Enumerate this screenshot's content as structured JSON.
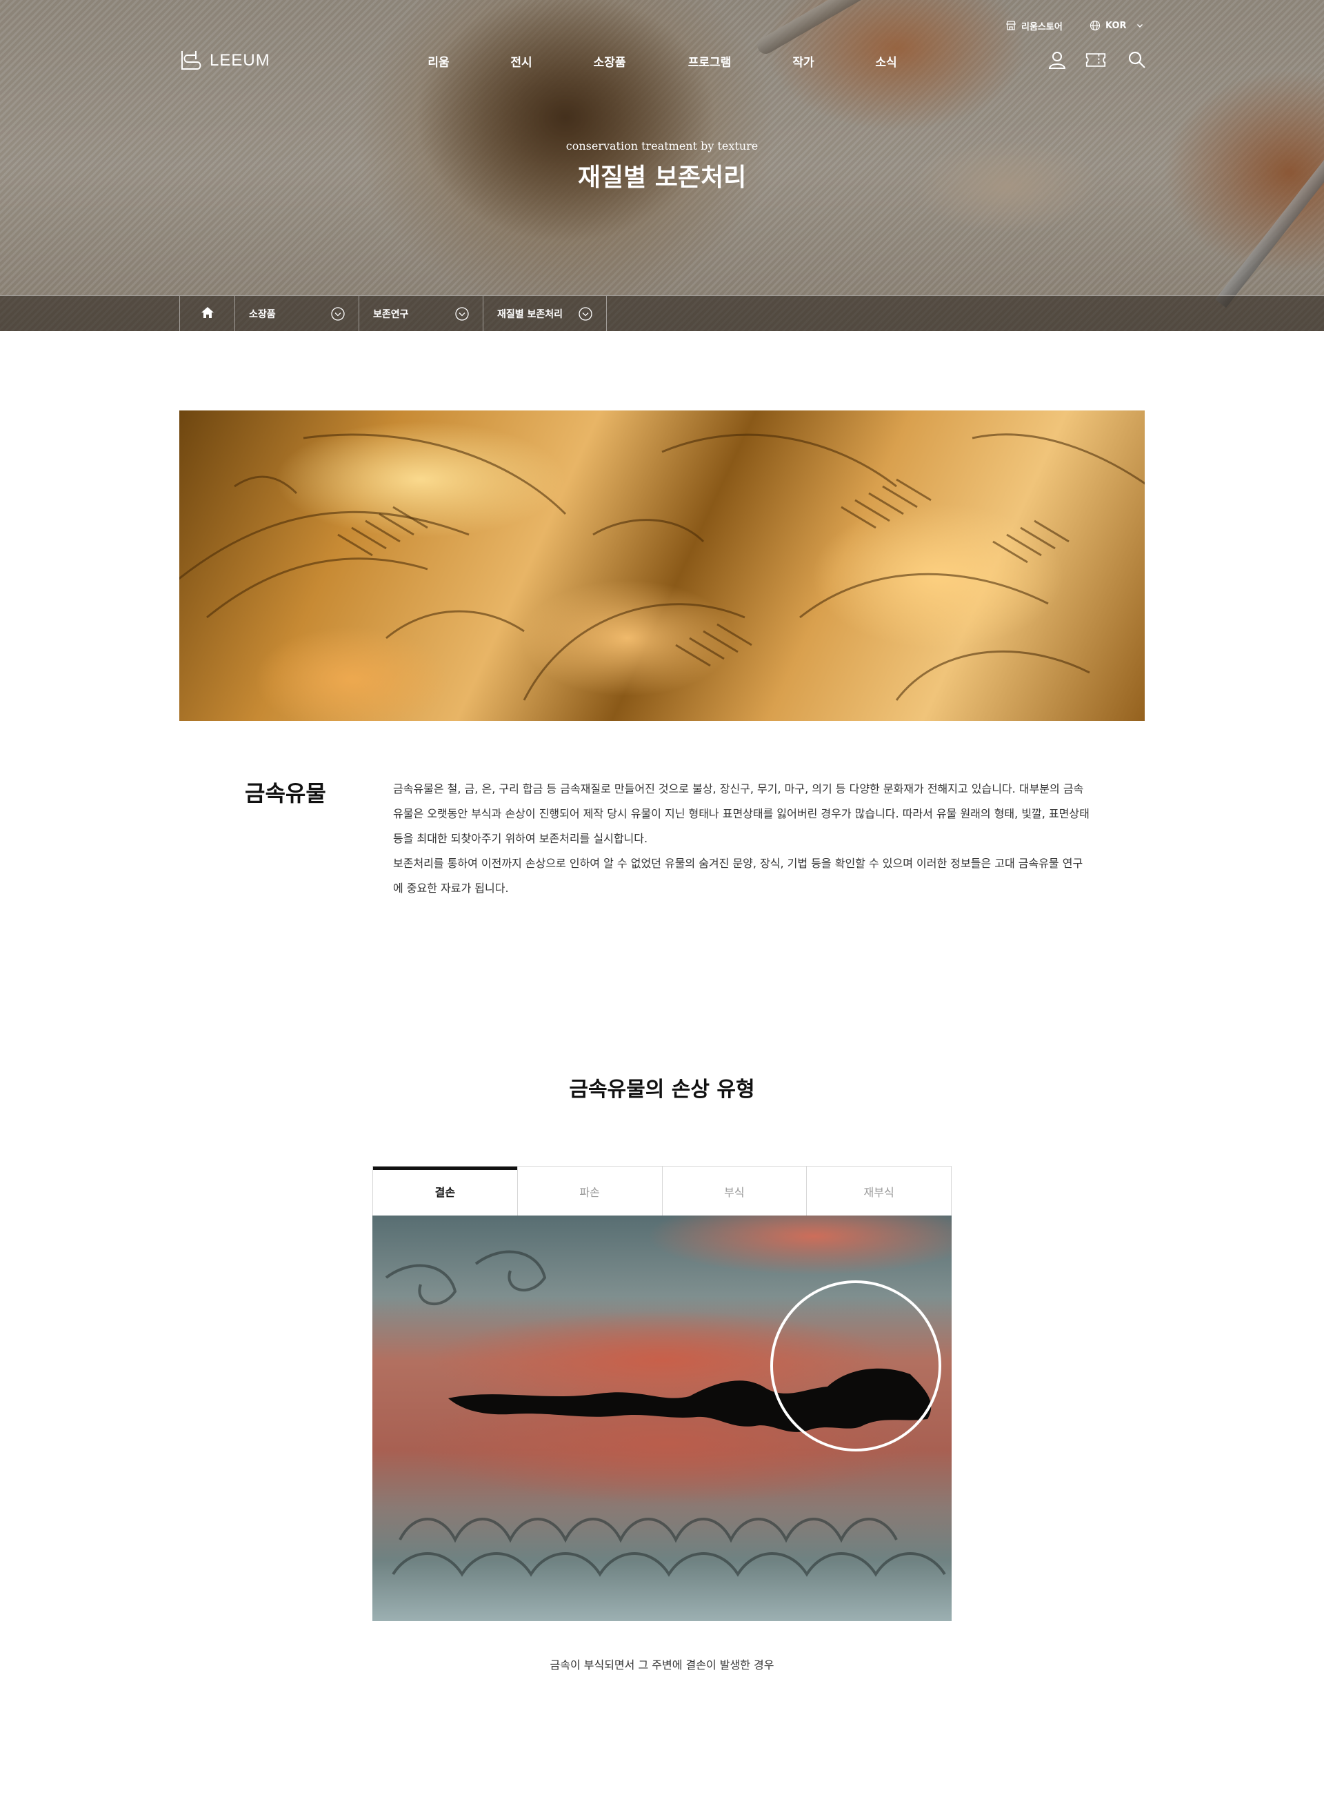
{
  "header": {
    "utility": {
      "store_label": "리움스토어",
      "lang_label": "KOR"
    },
    "logo_text": "LEEUM",
    "nav": [
      {
        "label": "리움"
      },
      {
        "label": "전시"
      },
      {
        "label": "소장품"
      },
      {
        "label": "프로그램"
      },
      {
        "label": "작가"
      },
      {
        "label": "소식"
      }
    ],
    "icons": [
      "user-icon",
      "ticket-icon",
      "search-icon"
    ]
  },
  "hero": {
    "subtitle": "conservation treatment by texture",
    "title": "재질별 보존처리"
  },
  "breadcrumb": {
    "home_icon": "home-icon",
    "items": [
      {
        "label": "소장품"
      },
      {
        "label": "보존연구"
      },
      {
        "label": "재질별 보존처리"
      }
    ]
  },
  "intro": {
    "title": "금속유물",
    "paragraphs": [
      "금속유물은 철, 금, 은, 구리 합금 등 금속재질로 만들어진 것으로 불상, 장신구, 무기, 마구, 의기 등 다양한 문화재가 전해지고 있습니다. 대부분의 금속유물은 오랫동안 부식과 손상이 진행되어 제작 당시 유물이 지닌 형태나 표면상태를 잃어버린 경우가 많습니다. 따라서 유물 원래의 형태, 빛깔, 표면상태 등을 최대한 되찾아주기 위하여 보존처리를 실시합니다.",
      "보존처리를 통하여 이전까지 손상으로 인하여 알 수 없었던 유물의 숨겨진 문양, 장식, 기법 등을 확인할 수 있으며 이러한 정보들은 고대 금속유물 연구에 중요한 자료가 됩니다."
    ]
  },
  "damage": {
    "title": "금속유물의 손상 유형",
    "tabs": [
      {
        "label": "결손",
        "active": true
      },
      {
        "label": "파손",
        "active": false
      },
      {
        "label": "부식",
        "active": false
      },
      {
        "label": "재부식",
        "active": false
      }
    ],
    "caption": "금속이 부식되면서 그 주변에 결손이 발생한 경우"
  },
  "colors": {
    "accent": "#111111",
    "tab_inactive_text": "#999999",
    "border": "#d7d7d7",
    "body_text": "#333333"
  }
}
